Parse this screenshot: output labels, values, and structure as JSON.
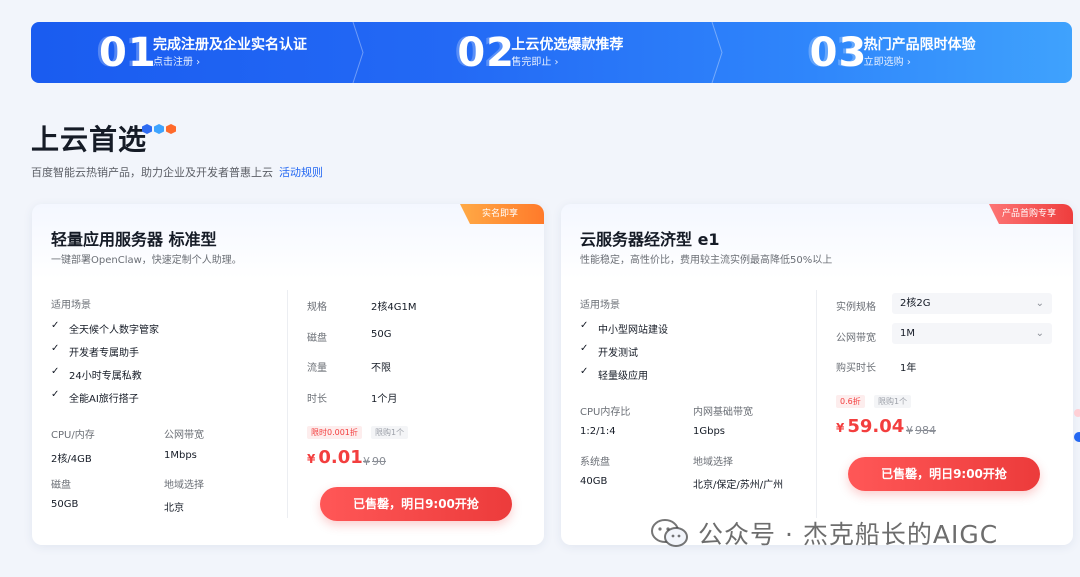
{
  "steps": [
    {
      "num": "01",
      "title": "完成注册及企业实名认证",
      "link": "点击注册"
    },
    {
      "num": "02",
      "title": "上云优选爆款推荐",
      "link": "售完即止"
    },
    {
      "num": "03",
      "title": "热门产品限时体验",
      "link": "立即选购"
    }
  ],
  "section": {
    "title": "上云首选",
    "desc": "百度智能云热销产品，助力企业及开发者普惠上云",
    "rules_link": "活动规则"
  },
  "colors": {
    "brand": "#2468f2",
    "price": "#f33e3e",
    "dot1": "#2e6bf2",
    "dot2": "#3ea4ff",
    "dot3": "#ff6a2b"
  },
  "card1": {
    "corner": "实名即享",
    "title": "轻量应用服务器 标准型",
    "desc": "一键部署OpenClaw，快速定制个人助理。",
    "scene_label": "适用场景",
    "features": [
      "全天候个人数字管家",
      "开发者专属助手",
      "24小时专属私教",
      "全能AI旅行搭子"
    ],
    "specs": [
      {
        "label": "CPU/内存",
        "value": "2核/4GB"
      },
      {
        "label": "公网带宽",
        "value": "1Mbps"
      },
      {
        "label": "磁盘",
        "value": "50GB"
      },
      {
        "label": "地域选择",
        "value": "北京"
      }
    ],
    "config": [
      {
        "label": "规格",
        "value": "2核4G1M"
      },
      {
        "label": "磁盘",
        "value": "50G"
      },
      {
        "label": "流量",
        "value": "不限"
      },
      {
        "label": "时长",
        "value": "1个月"
      }
    ],
    "badge_limit": "限时0.001折",
    "badge_limit_qty": "限购1个",
    "currency": "¥",
    "price": "0.01",
    "orig_price": "90",
    "button": "已售罄，明日9:00开抢"
  },
  "card2": {
    "corner": "产品首购专享",
    "title": "云服务器经济型 e1",
    "desc": "性能稳定，高性价比，费用较主流实例最高降低50%以上",
    "scene_label": "适用场景",
    "features": [
      "中小型网站建设",
      "开发测试",
      "轻量级应用"
    ],
    "specs": [
      {
        "label": "CPU内存比",
        "value": "1:2/1:4"
      },
      {
        "label": "内网基础带宽",
        "value": "1Gbps"
      },
      {
        "label": "系统盘",
        "value": "40GB"
      },
      {
        "label": "地域选择",
        "value": "北京/保定/苏州/广州"
      }
    ],
    "config": [
      {
        "label": "实例规格",
        "value": "2核2G"
      },
      {
        "label": "公网带宽",
        "value": "1M"
      },
      {
        "label": "购买时长",
        "value": "1年"
      }
    ],
    "badge_limit": "0.6折",
    "badge_limit_qty": "限购1个",
    "currency": "¥",
    "price": "59.04",
    "orig_price": "984",
    "button": "已售罄，明日9:00开抢"
  },
  "watermark": "公众号 · 杰克船长的AIGC"
}
